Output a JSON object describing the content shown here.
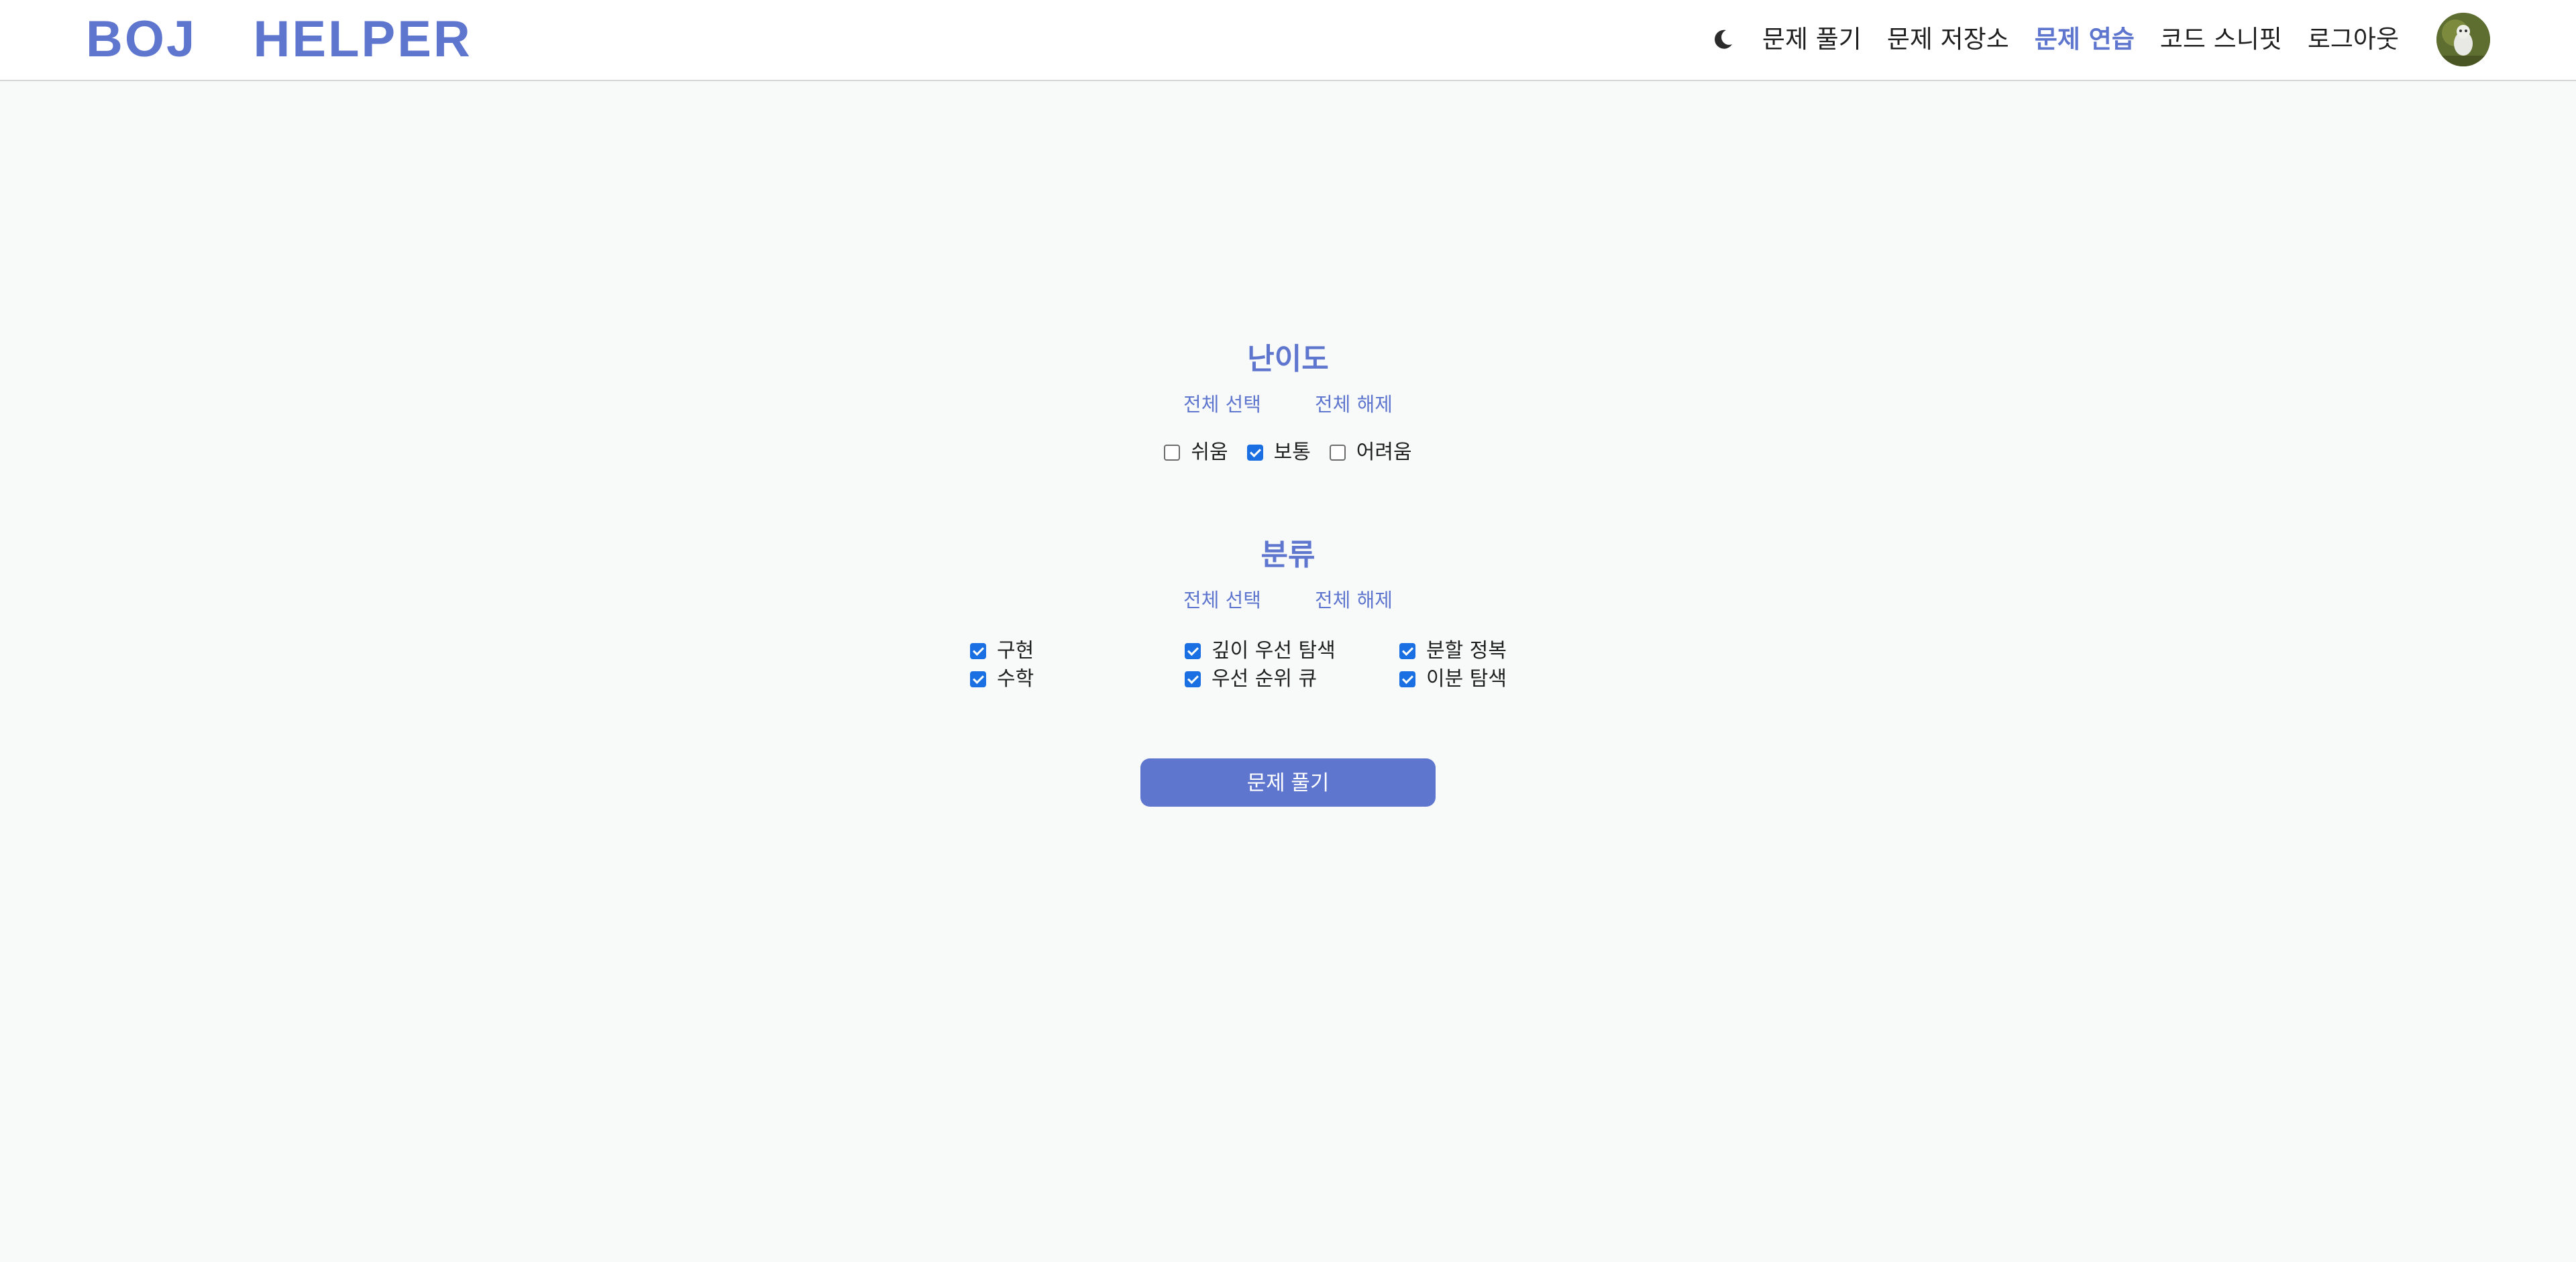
{
  "header": {
    "logo": "BOJ  HELPER",
    "theme_icon": "moon-icon",
    "nav": [
      {
        "label": "문제 풀기",
        "active": false
      },
      {
        "label": "문제 저장소",
        "active": false
      },
      {
        "label": "문제 연습",
        "active": true
      },
      {
        "label": "코드 스니핏",
        "active": false
      },
      {
        "label": "로그아웃",
        "active": false
      }
    ],
    "avatar_icon": "user-avatar"
  },
  "difficulty": {
    "title": "난이도",
    "select_all": "전체 선택",
    "deselect_all": "전체 해제",
    "options": [
      {
        "label": "쉬움",
        "checked": false
      },
      {
        "label": "보통",
        "checked": true
      },
      {
        "label": "어려움",
        "checked": false
      }
    ]
  },
  "category": {
    "title": "분류",
    "select_all": "전체 선택",
    "deselect_all": "전체 해제",
    "options": [
      {
        "label": "구현",
        "checked": true
      },
      {
        "label": "깊이 우선 탐색",
        "checked": true
      },
      {
        "label": "분할 정복",
        "checked": true
      },
      {
        "label": "수학",
        "checked": true
      },
      {
        "label": "우선 순위 큐",
        "checked": true
      },
      {
        "label": "이분 탐색",
        "checked": true
      }
    ]
  },
  "submit": {
    "label": "문제 풀기"
  },
  "colors": {
    "accent": "#5f76cf",
    "checkbox": "#1a6fe3",
    "background": "#f8f9f9"
  }
}
